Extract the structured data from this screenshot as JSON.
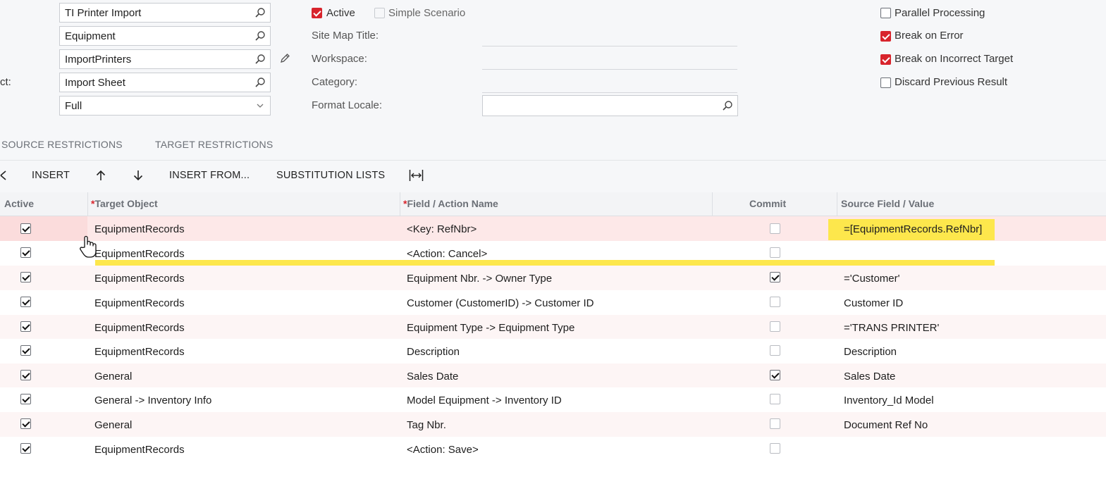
{
  "form": {
    "fields": [
      {
        "value": "TI Printer Import"
      },
      {
        "value": "Equipment"
      },
      {
        "value": "ImportPrinters"
      },
      {
        "value": "Import Sheet"
      },
      {
        "value": "Full"
      }
    ],
    "side_label_fragment": "ct:",
    "active_label": "Active",
    "simple_scenario_label": "Simple Scenario",
    "site_map_title_label": "Site Map Title:",
    "workspace_label": "Workspace:",
    "category_label": "Category:",
    "format_locale_label": "Format Locale:",
    "format_locale_value": "",
    "options": {
      "parallel_processing": "Parallel Processing",
      "break_on_error": "Break on Error",
      "break_on_incorrect_target": "Break on Incorrect Target",
      "discard_previous_result": "Discard Previous Result"
    }
  },
  "tabs": [
    "SOURCE RESTRICTIONS",
    "TARGET RESTRICTIONS"
  ],
  "toolbar": {
    "insert": "INSERT",
    "insert_from": "INSERT FROM...",
    "substitution_lists": "SUBSTITUTION LISTS"
  },
  "grid": {
    "columns": {
      "active": "Active",
      "target_object": "Target Object",
      "field_action": "Field / Action Name",
      "commit": "Commit",
      "source_field": "Source Field / Value",
      "required_mark": "*"
    },
    "rows": [
      {
        "active": true,
        "target": "EquipmentRecords",
        "field": "<Key: RefNbr>",
        "commit": false,
        "source": "=[EquipmentRecords.RefNbr]"
      },
      {
        "active": true,
        "target": "EquipmentRecords",
        "field": "<Action: Cancel>",
        "commit": false,
        "source": ""
      },
      {
        "active": true,
        "target": "EquipmentRecords",
        "field": "Equipment Nbr. -> Owner Type",
        "commit": true,
        "source": "='Customer'"
      },
      {
        "active": true,
        "target": "EquipmentRecords",
        "field": "Customer (CustomerID) -> Customer ID",
        "commit": false,
        "source": "Customer ID"
      },
      {
        "active": true,
        "target": "EquipmentRecords",
        "field": "Equipment Type -> Equipment Type",
        "commit": false,
        "source": "='TRANS PRINTER'"
      },
      {
        "active": true,
        "target": "EquipmentRecords",
        "field": "Description",
        "commit": false,
        "source": "Description"
      },
      {
        "active": true,
        "target": "General",
        "field": "Sales Date",
        "commit": true,
        "source": "Sales Date"
      },
      {
        "active": true,
        "target": "General -> Inventory Info",
        "field": "Model Equipment -> Inventory ID",
        "commit": false,
        "source": "Inventory_Id Model"
      },
      {
        "active": true,
        "target": "General",
        "field": "Tag Nbr.",
        "commit": false,
        "source": "Document Ref No"
      },
      {
        "active": true,
        "target": "EquipmentRecords",
        "field": "<Action: Save>",
        "commit": false,
        "source": ""
      }
    ]
  },
  "colors": {
    "accent_red": "#d8242c",
    "highlight_yellow": "#fde74c"
  }
}
